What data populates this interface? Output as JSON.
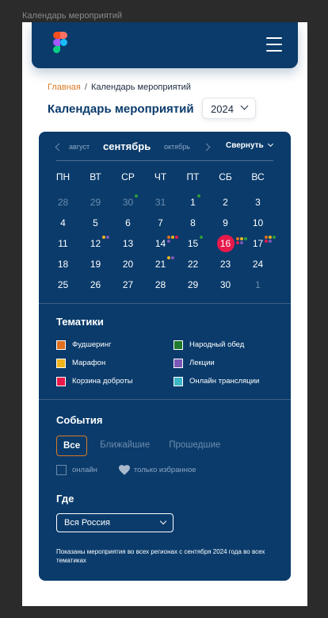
{
  "frame_label": "Календарь мероприятий",
  "breadcrumb": {
    "home": "Главная",
    "separator": "/",
    "current": "Календарь мероприятий"
  },
  "page_title": "Календарь мероприятий",
  "year": "2024",
  "calendar": {
    "prev_month": "август",
    "current_month": "сентябрь",
    "next_month": "октябрь",
    "collapse_label": "Свернуть",
    "weekdays": [
      "ПН",
      "ВТ",
      "СР",
      "ЧТ",
      "ПТ",
      "СБ",
      "ВС"
    ],
    "days": [
      {
        "n": "28",
        "muted": true
      },
      {
        "n": "29",
        "muted": true
      },
      {
        "n": "30",
        "muted": true,
        "dots": [
          "#2e9c3c"
        ]
      },
      {
        "n": "31",
        "muted": true
      },
      {
        "n": "1",
        "dots": [
          "#2e9c3c"
        ]
      },
      {
        "n": "2"
      },
      {
        "n": "3"
      },
      {
        "n": "4"
      },
      {
        "n": "5"
      },
      {
        "n": "6"
      },
      {
        "n": "7"
      },
      {
        "n": "8"
      },
      {
        "n": "9"
      },
      {
        "n": "10"
      },
      {
        "n": "11"
      },
      {
        "n": "12",
        "dots": [
          "#f0b41c",
          "#7a58b6"
        ]
      },
      {
        "n": "13"
      },
      {
        "n": "14",
        "dots": [
          "#e0701f",
          "#f0b41c",
          "#e8194a",
          "#7a58b6"
        ]
      },
      {
        "n": "15",
        "dots": [
          "#2e9c3c"
        ]
      },
      {
        "n": "16",
        "today": true,
        "dots": [
          "#e0701f",
          "#f0b41c",
          "#2e9c3c",
          "#e8194a",
          "#7a58b6"
        ]
      },
      {
        "n": "17",
        "dots": [
          "#e0701f",
          "#f0b41c",
          "#2e9c3c",
          "#e8194a",
          "#7a58b6"
        ]
      },
      {
        "n": "18"
      },
      {
        "n": "19"
      },
      {
        "n": "20"
      },
      {
        "n": "21",
        "dots": [
          "#f0b41c",
          "#7a58b6"
        ]
      },
      {
        "n": "22"
      },
      {
        "n": "23"
      },
      {
        "n": "24"
      },
      {
        "n": "25"
      },
      {
        "n": "26"
      },
      {
        "n": "27"
      },
      {
        "n": "28"
      },
      {
        "n": "29"
      },
      {
        "n": "30"
      },
      {
        "n": "1",
        "muted": true
      }
    ]
  },
  "themes": {
    "title": "Тематики",
    "items": [
      {
        "label": "Фудшеринг",
        "color": "#e0701f"
      },
      {
        "label": "Народный обед",
        "color": "#1e7a2c"
      },
      {
        "label": "Марафон",
        "color": "#f0b41c"
      },
      {
        "label": "Лекции",
        "color": "#7a58b6"
      },
      {
        "label": "Корзина доброты",
        "color": "#e8194a"
      },
      {
        "label": "Онлайн трансляции",
        "color": "#3fb6c6"
      }
    ]
  },
  "events": {
    "title": "События",
    "filters": [
      "Все",
      "Ближайшие",
      "Прошедшие"
    ],
    "online_label": "онлайн",
    "favorites_label": "только избранное"
  },
  "where": {
    "title": "Где",
    "region": "Вся Россия"
  },
  "note": "Показаны мероприятия во всех регионах с сентября 2024 года во всех тематиках"
}
